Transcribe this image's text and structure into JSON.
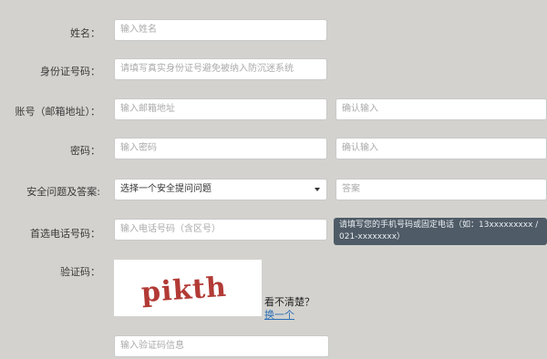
{
  "form": {
    "name": {
      "label": "姓名：",
      "placeholder": "输入姓名"
    },
    "id_number": {
      "label": "身份证号码：",
      "placeholder": "请填写真实身份证号避免被纳入防沉迷系统"
    },
    "account": {
      "label": "账号（邮箱地址）：",
      "placeholder": "输入邮箱地址",
      "confirm_placeholder": "确认输入"
    },
    "password": {
      "label": "密码：",
      "placeholder": "输入密码",
      "confirm_placeholder": "确认输入"
    },
    "security": {
      "label": "安全问题及答案:",
      "selected_option": "选择一个安全提问问题",
      "answer_placeholder": "答案"
    },
    "phone": {
      "label": "首选电话号码：",
      "placeholder": "输入电话号码（含区号）",
      "tooltip": "请填写您的手机号码或固定电话（如：13xxxxxxxxx / 021-xxxxxxxx）"
    },
    "captcha": {
      "label": "验证码：",
      "image_text": "pikth",
      "unclear_text": "看不清楚？",
      "swap_link": "换一个",
      "placeholder": "输入验证码信息"
    }
  }
}
